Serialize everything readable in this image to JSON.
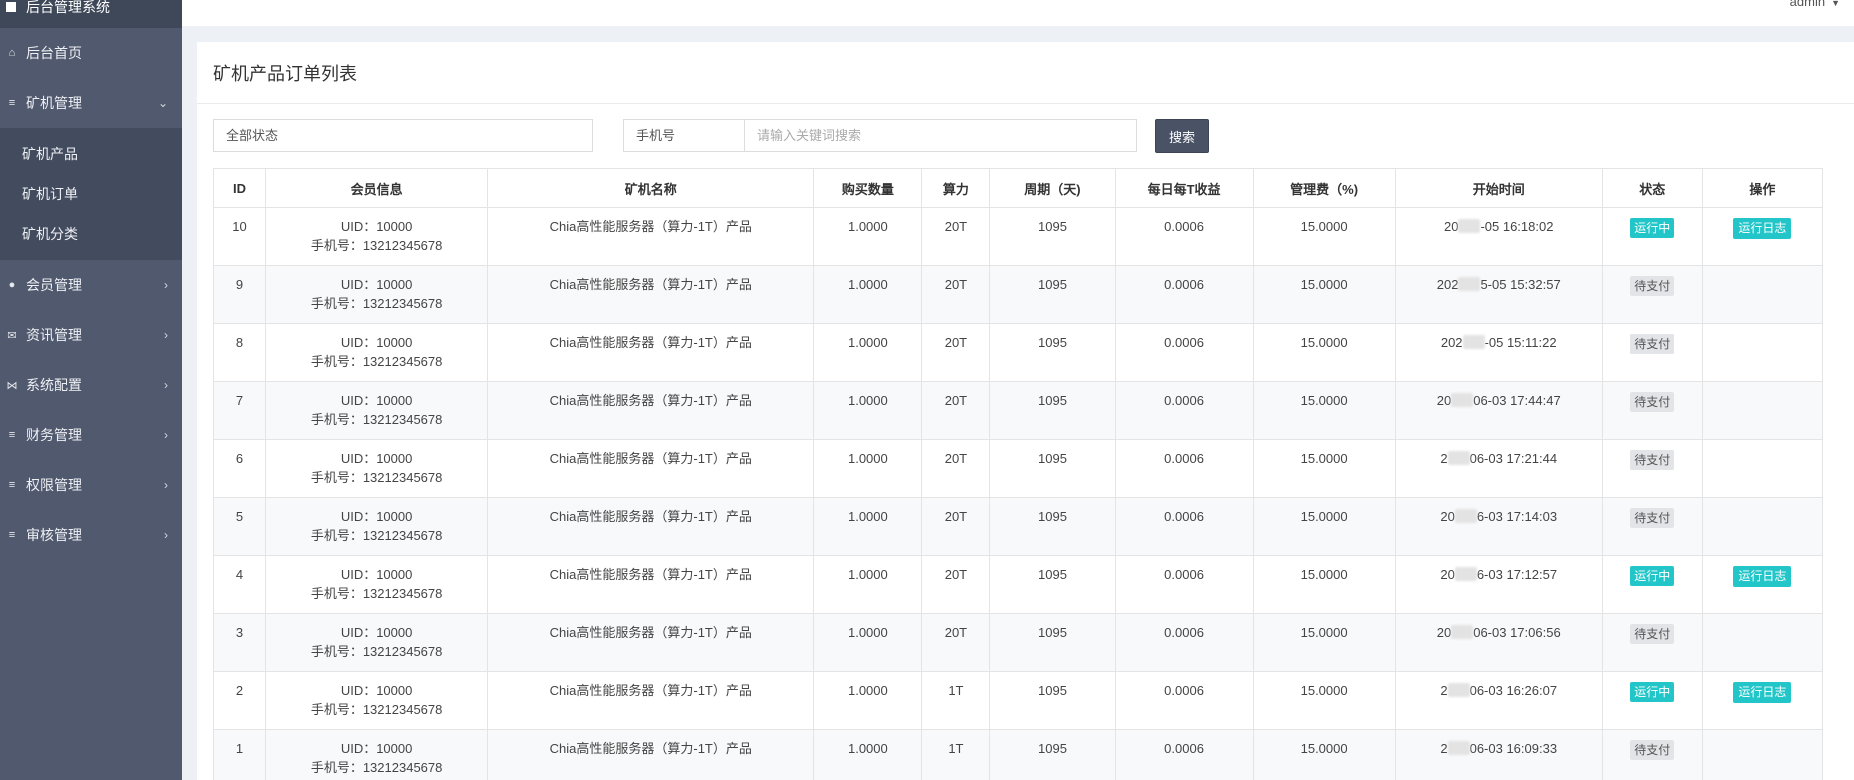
{
  "brand": {
    "title": "后台管理系统"
  },
  "user": {
    "name": "admin"
  },
  "sidebar": {
    "items": [
      {
        "label": "后台首页",
        "icon": "home-icon"
      },
      {
        "label": "矿机管理",
        "icon": "list-icon",
        "expanded": true,
        "children": [
          {
            "label": "矿机产品"
          },
          {
            "label": "矿机订单"
          },
          {
            "label": "矿机分类"
          }
        ]
      },
      {
        "label": "会员管理",
        "icon": "user-icon"
      },
      {
        "label": "资讯管理",
        "icon": "envelope-icon"
      },
      {
        "label": "系统配置",
        "icon": "share-icon"
      },
      {
        "label": "财务管理",
        "icon": "list-icon"
      },
      {
        "label": "权限管理",
        "icon": "list-icon"
      },
      {
        "label": "审核管理",
        "icon": "list-icon"
      }
    ]
  },
  "page": {
    "title": "矿机产品订单列表"
  },
  "filters": {
    "status_select": "全部状态",
    "search_type": "手机号",
    "search_placeholder": "请输入关键词搜索",
    "search_button": "搜索"
  },
  "table": {
    "columns": [
      "ID",
      "会员信息",
      "矿机名称",
      "购买数量",
      "算力",
      "周期（天)",
      "每日每T收益",
      "管理费（%)",
      "开始时间",
      "状态",
      "操作"
    ],
    "rows": [
      {
        "id": "10",
        "uid": "UID：10000",
        "phone": "手机号：13212345678",
        "name": "Chia高性能服务器（算力-1T）产品",
        "qty": "1.0000",
        "power": "20T",
        "period": "1095",
        "daily": "0.0006",
        "fee": "15.0000",
        "time_prefix": "20",
        "time_suffix": "-05 16:18:02",
        "status": "运行中",
        "status_type": "running",
        "action": "运行日志"
      },
      {
        "id": "9",
        "uid": "UID：10000",
        "phone": "手机号：13212345678",
        "name": "Chia高性能服务器（算力-1T）产品",
        "qty": "1.0000",
        "power": "20T",
        "period": "1095",
        "daily": "0.0006",
        "fee": "15.0000",
        "time_prefix": "202",
        "time_suffix": "5-05 15:32:57",
        "status": "待支付",
        "status_type": "pending",
        "action": ""
      },
      {
        "id": "8",
        "uid": "UID：10000",
        "phone": "手机号：13212345678",
        "name": "Chia高性能服务器（算力-1T）产品",
        "qty": "1.0000",
        "power": "20T",
        "period": "1095",
        "daily": "0.0006",
        "fee": "15.0000",
        "time_prefix": "202",
        "time_suffix": "-05 15:11:22",
        "status": "待支付",
        "status_type": "pending",
        "action": ""
      },
      {
        "id": "7",
        "uid": "UID：10000",
        "phone": "手机号：13212345678",
        "name": "Chia高性能服务器（算力-1T）产品",
        "qty": "1.0000",
        "power": "20T",
        "period": "1095",
        "daily": "0.0006",
        "fee": "15.0000",
        "time_prefix": "20",
        "time_suffix": "06-03 17:44:47",
        "status": "待支付",
        "status_type": "pending",
        "action": ""
      },
      {
        "id": "6",
        "uid": "UID：10000",
        "phone": "手机号：13212345678",
        "name": "Chia高性能服务器（算力-1T）产品",
        "qty": "1.0000",
        "power": "20T",
        "period": "1095",
        "daily": "0.0006",
        "fee": "15.0000",
        "time_prefix": "2",
        "time_suffix": "06-03 17:21:44",
        "status": "待支付",
        "status_type": "pending",
        "action": ""
      },
      {
        "id": "5",
        "uid": "UID：10000",
        "phone": "手机号：13212345678",
        "name": "Chia高性能服务器（算力-1T）产品",
        "qty": "1.0000",
        "power": "20T",
        "period": "1095",
        "daily": "0.0006",
        "fee": "15.0000",
        "time_prefix": "20",
        "time_suffix": "6-03 17:14:03",
        "status": "待支付",
        "status_type": "pending",
        "action": ""
      },
      {
        "id": "4",
        "uid": "UID：10000",
        "phone": "手机号：13212345678",
        "name": "Chia高性能服务器（算力-1T）产品",
        "qty": "1.0000",
        "power": "20T",
        "period": "1095",
        "daily": "0.0006",
        "fee": "15.0000",
        "time_prefix": "20",
        "time_suffix": "6-03 17:12:57",
        "status": "运行中",
        "status_type": "running",
        "action": "运行日志"
      },
      {
        "id": "3",
        "uid": "UID：10000",
        "phone": "手机号：13212345678",
        "name": "Chia高性能服务器（算力-1T）产品",
        "qty": "1.0000",
        "power": "20T",
        "period": "1095",
        "daily": "0.0006",
        "fee": "15.0000",
        "time_prefix": "20",
        "time_suffix": "06-03 17:06:56",
        "status": "待支付",
        "status_type": "pending",
        "action": ""
      },
      {
        "id": "2",
        "uid": "UID：10000",
        "phone": "手机号：13212345678",
        "name": "Chia高性能服务器（算力-1T）产品",
        "qty": "1.0000",
        "power": "1T",
        "period": "1095",
        "daily": "0.0006",
        "fee": "15.0000",
        "time_prefix": "2",
        "time_suffix": "06-03 16:26:07",
        "status": "运行中",
        "status_type": "running",
        "action": "运行日志"
      },
      {
        "id": "1",
        "uid": "UID：10000",
        "phone": "手机号：13212345678",
        "name": "Chia高性能服务器（算力-1T）产品",
        "qty": "1.0000",
        "power": "1T",
        "period": "1095",
        "daily": "0.0006",
        "fee": "15.0000",
        "time_prefix": "2",
        "time_suffix": "06-03 16:09:33",
        "status": "待支付",
        "status_type": "pending",
        "action": ""
      }
    ]
  },
  "colors": {
    "sidebar": "#50596d",
    "accent": "#23c6c8",
    "search_button": "#4a5366"
  }
}
